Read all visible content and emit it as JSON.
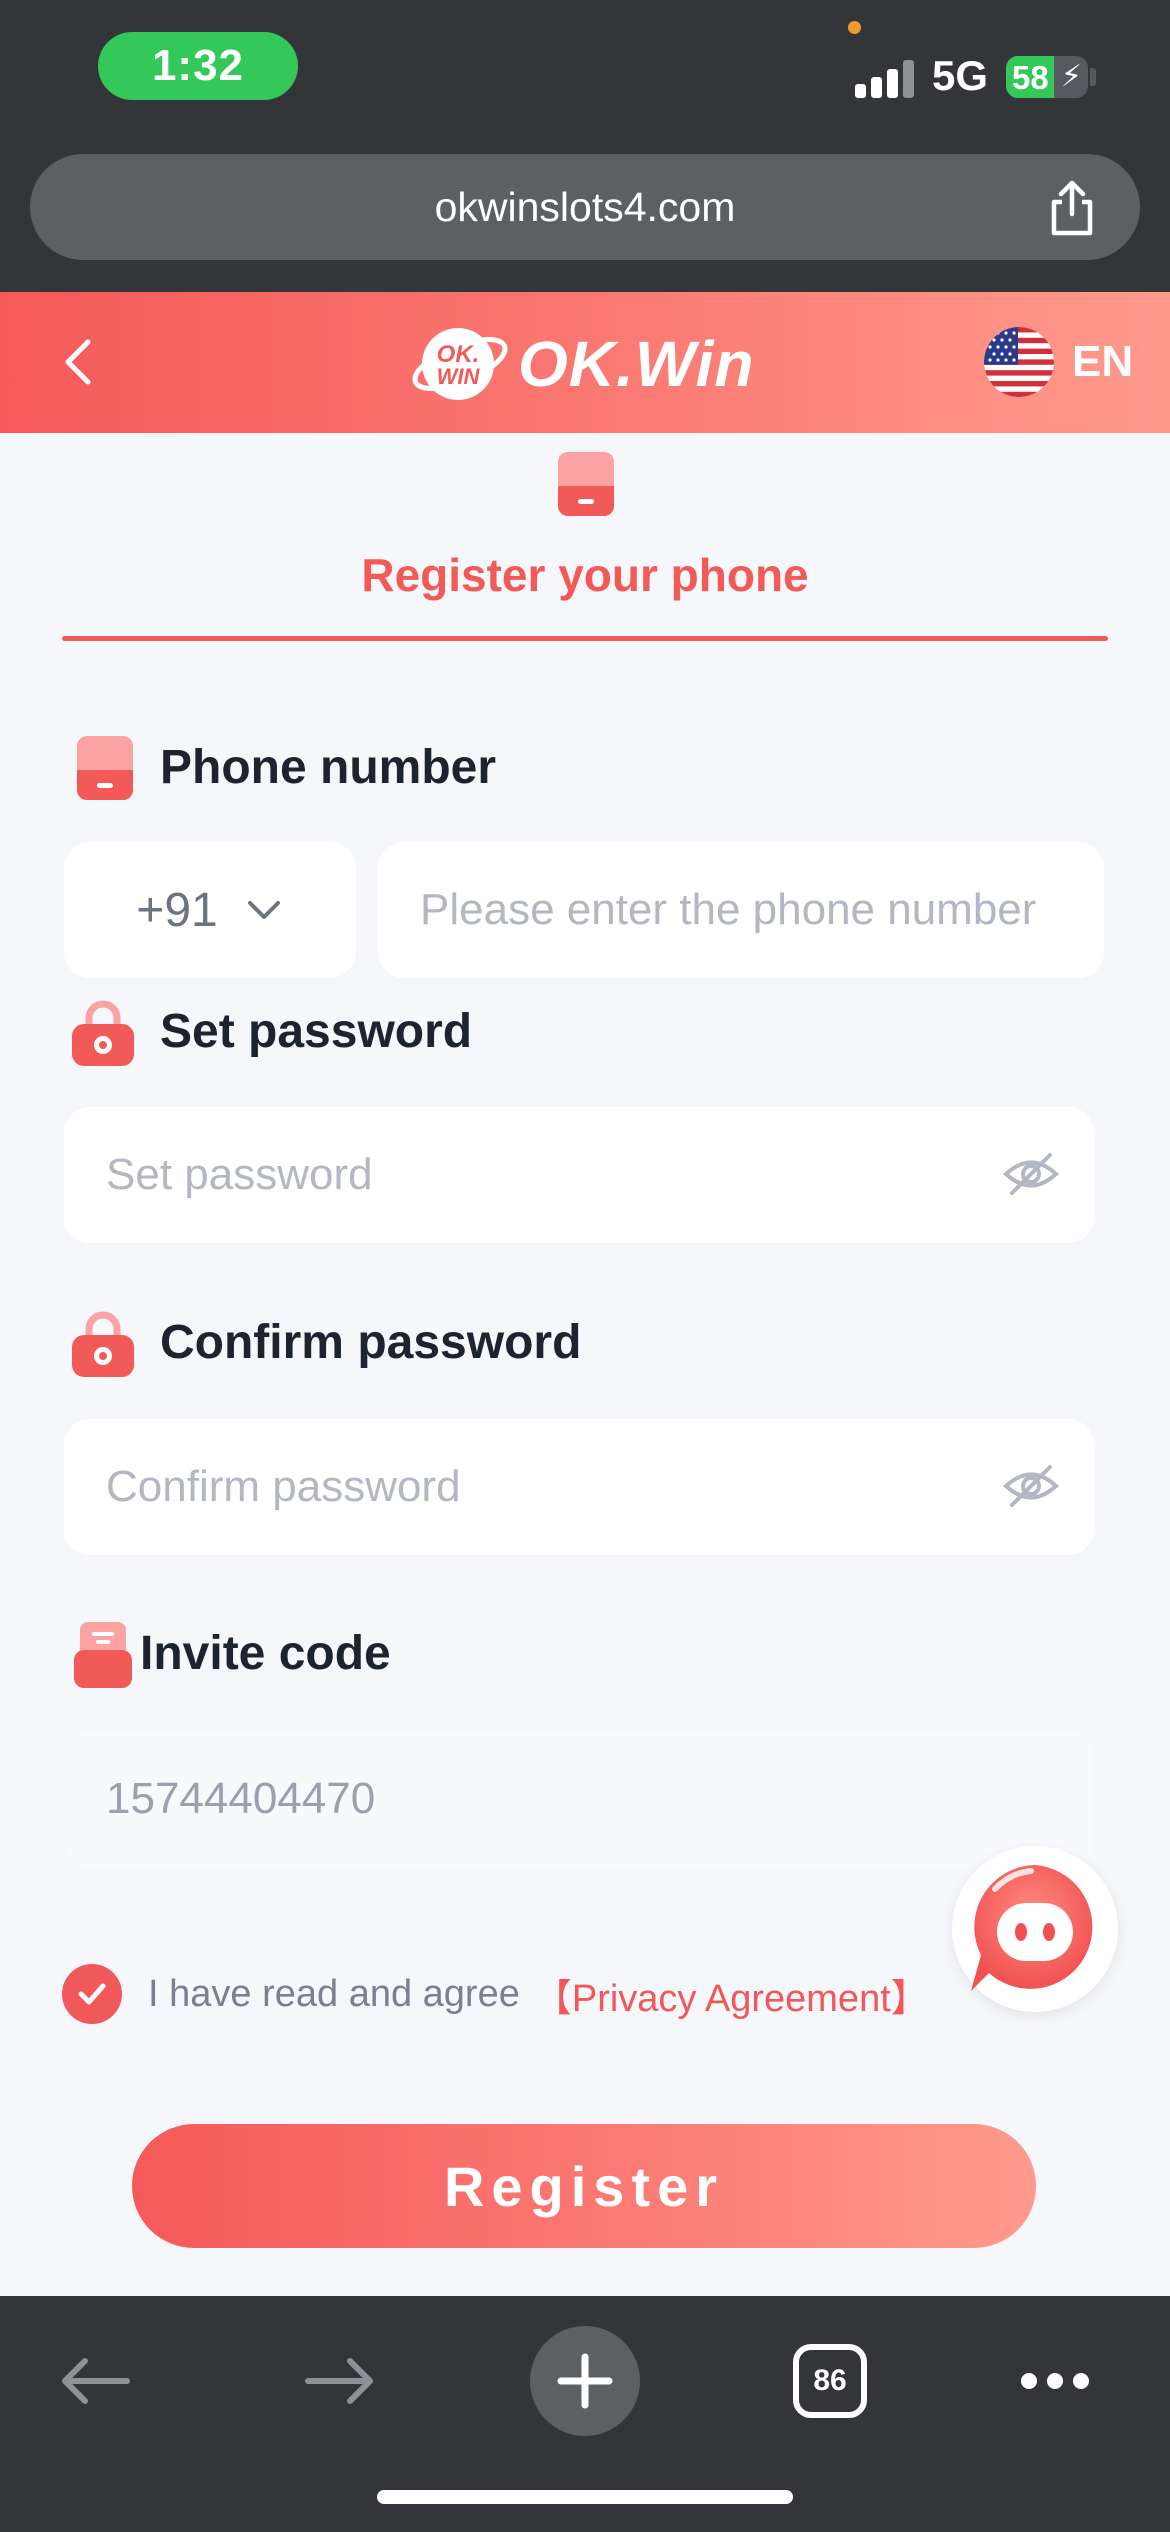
{
  "status_bar": {
    "time": "1:32",
    "network": "5G",
    "battery_percent": "58",
    "battery_level": 0.58
  },
  "browser": {
    "url": "okwinslots4.com",
    "tabs_count": "86"
  },
  "header": {
    "logo_badge": "OK. WIN",
    "logo_text": "OK.Win",
    "language": "EN",
    "brand_color": "#f6595a"
  },
  "tab": {
    "title": "Register your phone"
  },
  "form": {
    "phone_label": "Phone number",
    "country_code": "+91",
    "phone_placeholder": "Please enter the phone number",
    "password_label": "Set password",
    "password_placeholder": "Set password",
    "confirm_label": "Confirm password",
    "confirm_placeholder": "Confirm password",
    "invite_label": "Invite code",
    "invite_placeholder": "15744404470"
  },
  "agreement": {
    "text": "I have read and agree",
    "link": "【Privacy Agreement】",
    "checked": true
  },
  "register_button": "Register",
  "icons": {
    "back": "chevron-left-icon",
    "share": "share-icon",
    "flag": "us-flag-icon",
    "phone": "phone-icon",
    "lock": "lock-icon",
    "eye": "eye-off-icon",
    "invite": "invite-icon",
    "support": "chat-support-icon",
    "nav_back": "arrow-left-icon",
    "nav_forward": "arrow-right-icon",
    "new_tab": "plus-icon",
    "more": "more-icon"
  }
}
